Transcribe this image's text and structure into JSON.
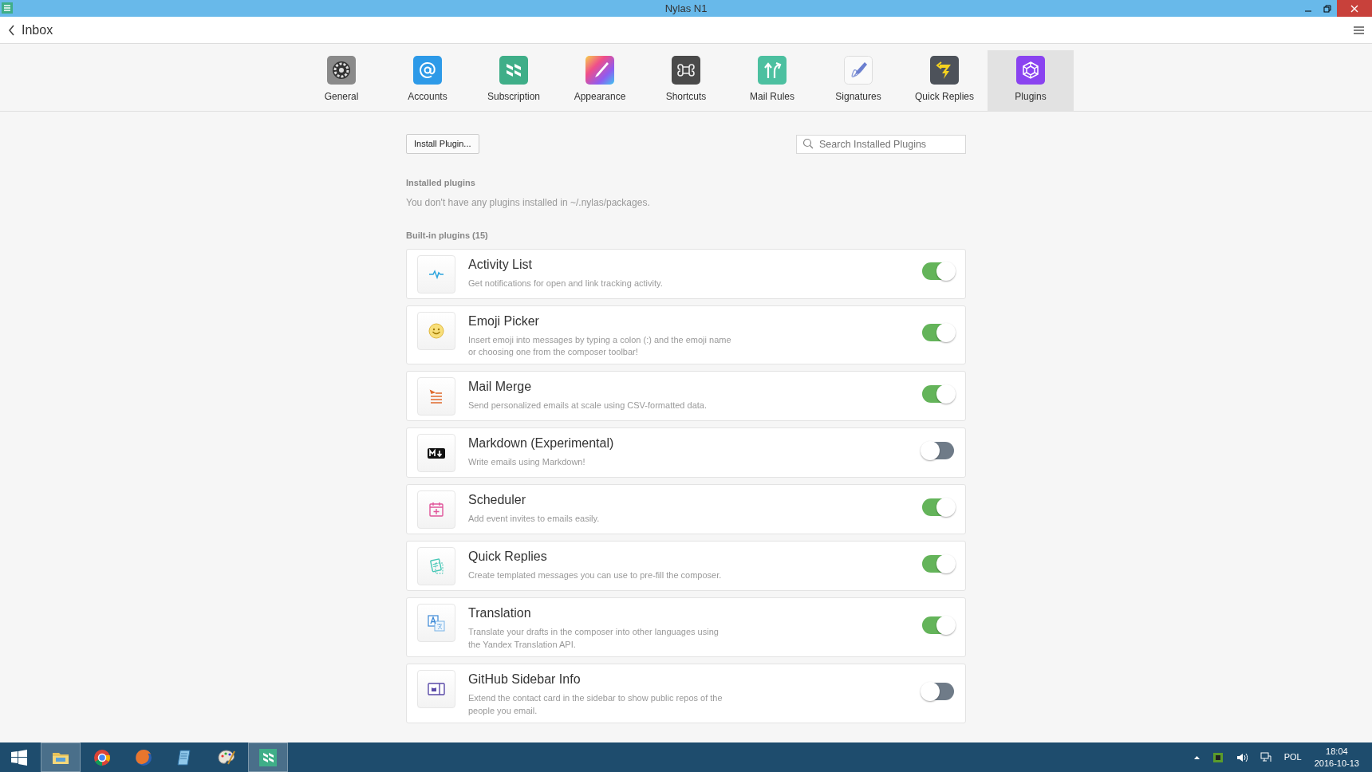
{
  "window": {
    "title": "Nylas N1"
  },
  "toolbar": {
    "back_label": "Inbox"
  },
  "tabs": [
    {
      "label": "General",
      "selected": false
    },
    {
      "label": "Accounts",
      "selected": false
    },
    {
      "label": "Subscription",
      "selected": false
    },
    {
      "label": "Appearance",
      "selected": false
    },
    {
      "label": "Shortcuts",
      "selected": false
    },
    {
      "label": "Mail Rules",
      "selected": false
    },
    {
      "label": "Signatures",
      "selected": false
    },
    {
      "label": "Quick Replies",
      "selected": false
    },
    {
      "label": "Plugins",
      "selected": true
    }
  ],
  "install_button": "Install Plugin...",
  "search": {
    "placeholder": "Search Installed Plugins"
  },
  "installed": {
    "heading": "Installed plugins",
    "message": "You don't have any plugins installed in ~/.nylas/packages."
  },
  "builtin": {
    "heading": "Built-in plugins (15)",
    "plugins": [
      {
        "name": "Activity List",
        "description": "Get notifications for open and link tracking activity.",
        "enabled": true
      },
      {
        "name": "Emoji Picker",
        "description": "Insert emoji into messages by typing a colon (:) and the emoji name or choosing one from the composer toolbar!",
        "enabled": true
      },
      {
        "name": "Mail Merge",
        "description": "Send personalized emails at scale using CSV-formatted data.",
        "enabled": true
      },
      {
        "name": "Markdown (Experimental)",
        "description": "Write emails using Markdown!",
        "enabled": false
      },
      {
        "name": "Scheduler",
        "description": "Add event invites to emails easily.",
        "enabled": true
      },
      {
        "name": "Quick Replies",
        "description": "Create templated messages you can use to pre-fill the composer.",
        "enabled": true
      },
      {
        "name": "Translation",
        "description": "Translate your drafts in the composer into other languages using the Yandex Translation API.",
        "enabled": true
      },
      {
        "name": "GitHub Sidebar Info",
        "description": "Extend the contact card in the sidebar to show public repos of the people you email.",
        "enabled": false
      }
    ]
  },
  "taskbar": {
    "apps": [
      {
        "selected": true
      },
      {
        "selected": false
      },
      {
        "selected": false
      },
      {
        "selected": false
      },
      {
        "selected": false
      },
      {
        "selected": true
      }
    ],
    "language": "POL",
    "time": "18:04",
    "date": "2016-10-13"
  }
}
